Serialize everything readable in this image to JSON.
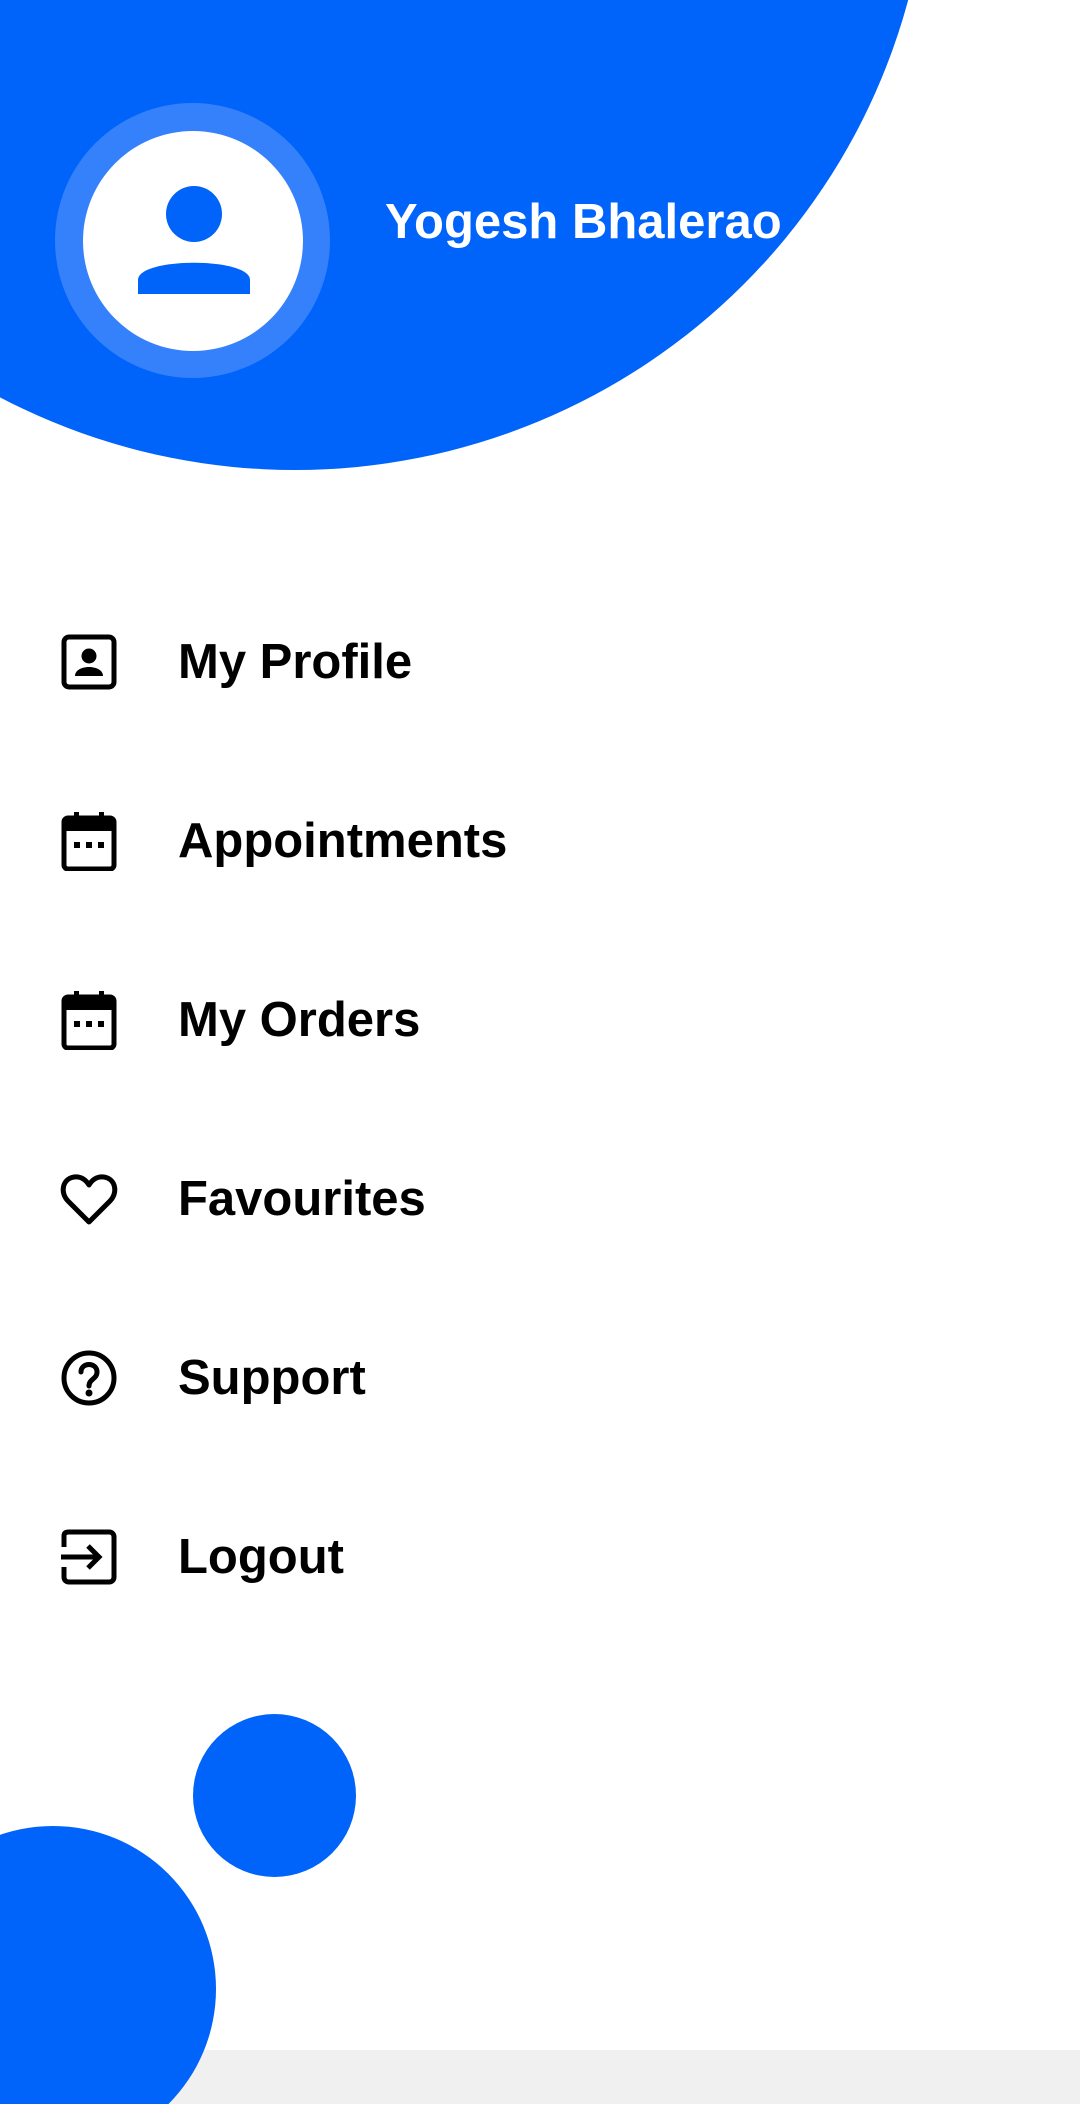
{
  "colors": {
    "brand": "#0063fa",
    "avatar_ring": "#3581fb",
    "background": "#ffffff",
    "text": "#000000",
    "bottom_bar": "#f0f0f0"
  },
  "header": {
    "user_name": "Yogesh Bhalerao",
    "avatar_icon": "person-icon"
  },
  "menu": {
    "items": [
      {
        "label": "My Profile",
        "icon": "account-box-icon"
      },
      {
        "label": "Appointments",
        "icon": "calendar-icon"
      },
      {
        "label": "My Orders",
        "icon": "calendar-icon"
      },
      {
        "label": "Favourites",
        "icon": "heart-outline-icon"
      },
      {
        "label": "Support",
        "icon": "help-circle-icon"
      },
      {
        "label": "Logout",
        "icon": "logout-icon"
      }
    ]
  }
}
